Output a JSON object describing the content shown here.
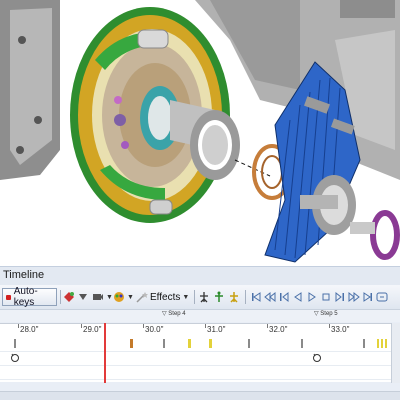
{
  "viewport": {
    "description_icon": "3d-model-icon"
  },
  "timeline": {
    "title": "Timeline",
    "toolbar": {
      "auto_keys_label": "Auto-keys",
      "effects_label": "Effects"
    },
    "steps": [
      "Step 4",
      "Step 5"
    ],
    "ruler_ticks": [
      "28.0\"",
      "29.0\"",
      "30.0\"",
      "31.0\"",
      "32.0\"",
      "33.0\""
    ],
    "colors": {
      "accent": "#d21f1f",
      "playhead": "#e23a3a",
      "panel_bg": "#e9eef6"
    }
  }
}
